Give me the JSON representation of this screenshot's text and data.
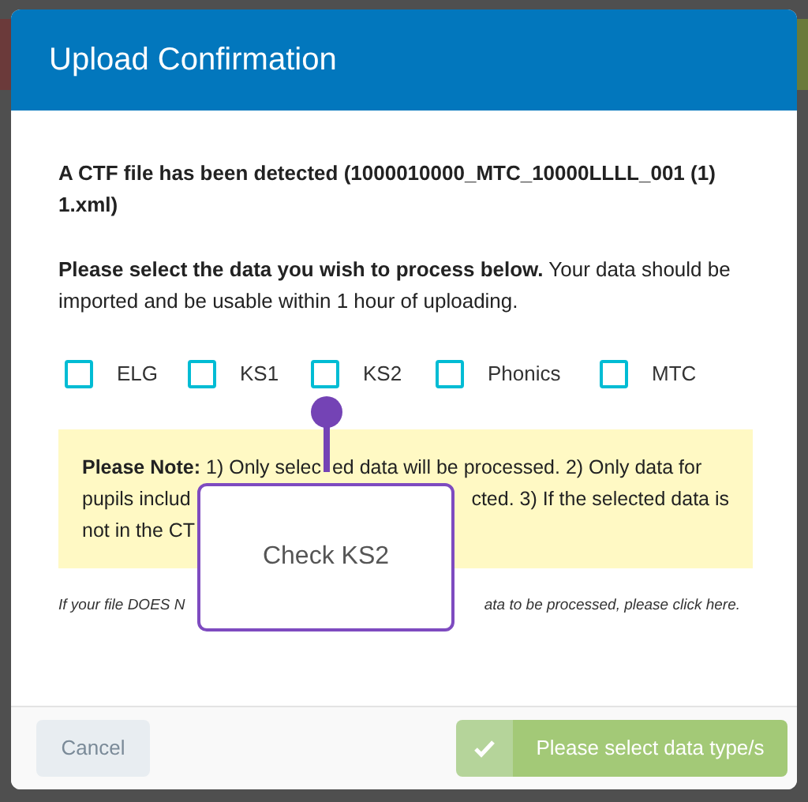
{
  "dialog": {
    "title": "Upload Confirmation",
    "detected_message": "A CTF file has been detected (1000010000_MTC_10000LLLL_001 (1) 1.xml)",
    "instruction": "**Please select the data you wish to process below.** Your data should be imported and be usable within 1 hour of uploading.",
    "data_types": [
      {
        "label": "ELG",
        "checked": false
      },
      {
        "label": "KS1",
        "checked": false
      },
      {
        "label": "KS2",
        "checked": false
      },
      {
        "label": "Phonics",
        "checked": false
      },
      {
        "label": "MTC",
        "checked": false
      }
    ],
    "note_lines": [
      {
        "parts": [
          "**Please Note:** 1) Only selec",
          "ed data will be processed. 2) Only data for"
        ]
      },
      {
        "parts": [
          "pupils includ",
          "cted. 3) If the selected data is"
        ]
      },
      {
        "parts": [
          "not in the CT"
        ]
      }
    ],
    "help_parts": [
      "If your file DOES N",
      "ata to be processed, please click here."
    ],
    "buttons": {
      "cancel": {
        "label": "Cancel"
      },
      "submit": {
        "label": "Please select data type/s",
        "disabled": true
      }
    }
  },
  "tooltip": {
    "text": "Check KS2"
  }
}
